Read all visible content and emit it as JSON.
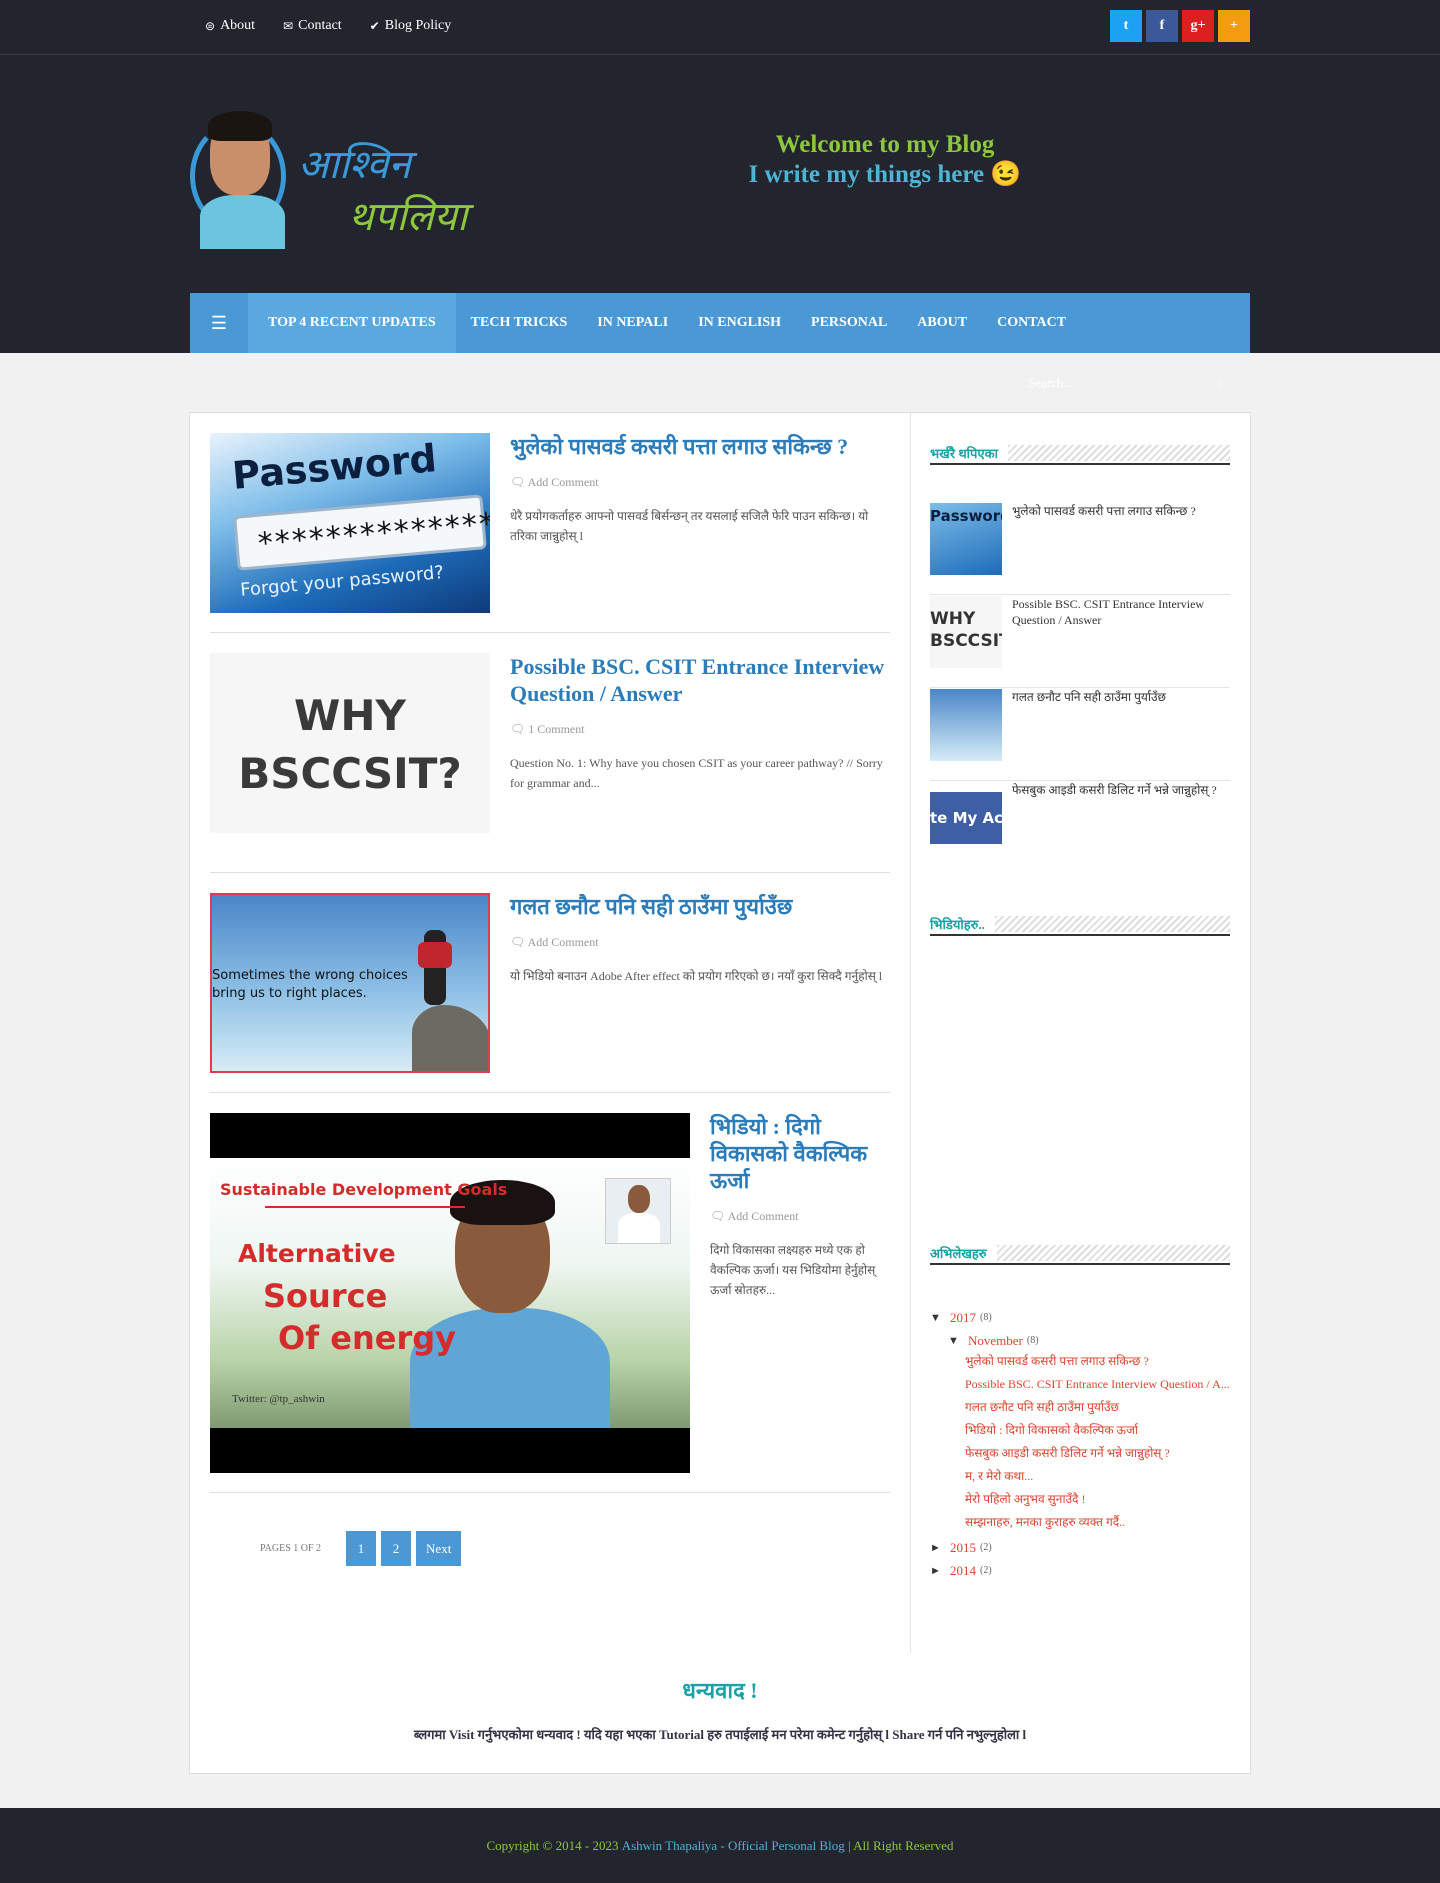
{
  "topnav": {
    "items": [
      {
        "icon": "globe-icon",
        "label": "About"
      },
      {
        "icon": "envelope-icon",
        "label": "Contact"
      },
      {
        "icon": "check-circle-icon",
        "label": "Blog Policy"
      }
    ],
    "socials": [
      {
        "icon": "twitter-icon",
        "glyph": "t",
        "color": "#1da1f2"
      },
      {
        "icon": "facebook-icon",
        "glyph": "f",
        "color": "#3b5998"
      },
      {
        "icon": "google-plus-icon",
        "glyph": "g+",
        "color": "#dd1f1f"
      },
      {
        "icon": "plus-icon",
        "glyph": "+",
        "color": "#f39c12"
      }
    ]
  },
  "header": {
    "logo_line1": "आश्विन",
    "logo_line2": "थपलिया",
    "welcome_line1": "Welcome to my Blog",
    "welcome_line2": "I write my things here 😉"
  },
  "mainnav": {
    "items": [
      "TOP 4 RECENT UPDATES",
      "TECH TRICKS",
      "IN NEPALI",
      "IN ENGLISH",
      "PERSONAL",
      "ABOUT",
      "CONTACT"
    ]
  },
  "search": {
    "placeholder": "Search..."
  },
  "posts": [
    {
      "title": "भुलेको पासवर्ड कसरी पत्ता लगाउ सकिन्छ ?",
      "meta": "Add Comment",
      "excerpt": "धेरै प्रयोगकर्ताहरु आफ्नो पासवर्ड बिर्सन्छन् तर यसलाई सजिलै फेरि पाउन सकिन्छ। यो तरिका जान्नुहोस् l",
      "thumb_text": [
        "Password",
        "*****************",
        "Forgot your password?"
      ]
    },
    {
      "title": "Possible BSC. CSIT Entrance Interview Question / Answer",
      "meta": "1 Comment",
      "excerpt": "Question No. 1: Why have you chosen CSIT as your career pathway? // Sorry for grammar and...",
      "thumb_text": [
        "WHY",
        "BSCCSIT?"
      ]
    },
    {
      "title": "गलत छनौट पनि सही ठाउँमा पुर्याउँछ",
      "meta": "Add Comment",
      "excerpt": "यो भिडियो बनाउन Adobe After effect को प्रयोग गरिएको छ। नयाँ कुरा सिक्दै गर्नुहोस् l",
      "thumb_text": [
        "Sometimes the wrong choices",
        "bring us to right places."
      ]
    },
    {
      "title": "भिडियो : दिगो विकासको वैकल्पिक ऊर्जा",
      "meta": "Add Comment",
      "excerpt": "दिगो विकासका लक्ष्यहरु मध्ये एक हो वैकल्पिक ऊर्जा। यस भिडियोमा हेर्नुहोस् ऊर्जा स्रोतहरु...",
      "thumb_text": [
        "Sustainable Development Goals",
        "Alternative",
        "Source",
        "Of energy",
        "Twitter: @tp_ashwin"
      ]
    }
  ],
  "pagination": {
    "label": "PAGES 1 OF 2",
    "pages": [
      "1",
      "2"
    ],
    "next": "Next"
  },
  "sidebar": {
    "recent_title": "भर्खरै थपिएका",
    "recent_items": [
      {
        "title": "भुलेको पासवर्ड कसरी पत्ता लगाउ सकिन्छ ?",
        "thumb": "Password"
      },
      {
        "title": "Possible BSC. CSIT Entrance Interview Question / Answer",
        "thumb": "WHY BSCCSIT"
      },
      {
        "title": "गलत छनौट पनि सही ठाउँमा पुर्याउँछ",
        "thumb": ""
      },
      {
        "title": "फेसबुक आइडी कसरी डिलिट गर्ने भन्ने जान्नुहोस् ?",
        "thumb": "te My Acc"
      }
    ],
    "video_title": "भिडियोहरु..",
    "archive_title": "अभिलेखहरु",
    "archive": {
      "y2017": {
        "label": "2017",
        "count": "(8)"
      },
      "nov": {
        "label": "November",
        "count": "(8)"
      },
      "posts": [
        "भुलेको पासवर्ड कसरी पत्ता लगाउ सकिन्छ ?",
        "Possible BSC. CSIT Entrance Interview Question / A...",
        "गलत छनौट पनि सही ठाउँमा पुर्याउँछ",
        "भिडियो : दिगो विकासको वैकल्पिक ऊर्जा",
        "फेसबुक आइडी कसरी डिलिट गर्ने भन्ने जान्नुहोस् ?",
        "म, र मेरो कथा...",
        "मेरो पहिलो अनुभव सुनाउँदै !",
        "सम्झनाहरु, मनका कुराहरु व्यक्त गर्दै.."
      ],
      "y2015": {
        "label": "2015",
        "count": "(2)"
      },
      "y2014": {
        "label": "2014",
        "count": "(2)"
      }
    }
  },
  "thanks": {
    "heading": "धन्यवाद !",
    "text": "ब्लगमा Visit गर्नुभएकोमा धन्यवाद ! यदि यहा भएका Tutorial हरु तपाईलाई मन परेमा कमेन्ट गर्नुहोस् l Share गर्न पनि नभुल्नुहोला l"
  },
  "footer": {
    "prefix": "Copyright © 2014 - 2023",
    "name": "Ashwin Thapaliya - Official Personal Blog",
    "suffix": "| All Right Reserved"
  }
}
